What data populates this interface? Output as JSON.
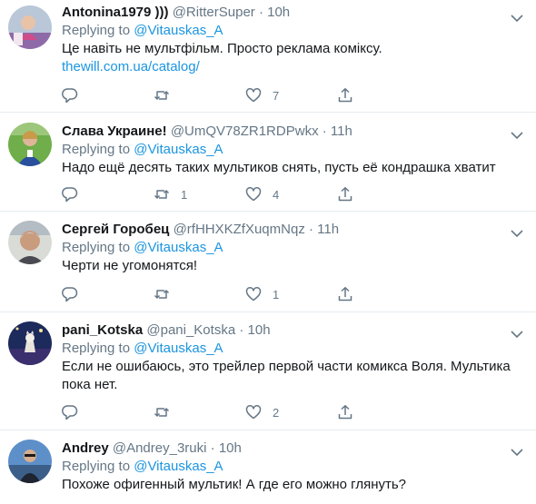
{
  "replying_label": "Replying to",
  "tweets": [
    {
      "name": "Antonina1979 )))",
      "handle": "@RitterSuper",
      "time": "10h",
      "reply_to": "@Vitauskas_A",
      "text": "Це навіть не мультфільм. Просто реклама коміксу.",
      "link": "thewill.com.ua/catalog/",
      "replies": "",
      "retweets": "",
      "likes": "7"
    },
    {
      "name": "Слава Украине!",
      "handle": "@UmQV78ZR1RDPwkx",
      "time": "11h",
      "reply_to": "@Vitauskas_A",
      "text": "Надо ещё десять таких мультиков снять, пусть её кондрашка хватит",
      "replies": "",
      "retweets": "1",
      "likes": "4"
    },
    {
      "name": "Сергей Горобец",
      "handle": "@rfHHXKZfXuqmNqz",
      "time": "11h",
      "reply_to": "@Vitauskas_A",
      "text": "Черти не угомонятся!",
      "replies": "",
      "retweets": "",
      "likes": "1"
    },
    {
      "name": "pani_Kotska",
      "handle": "@pani_Kotska",
      "time": "10h",
      "reply_to": "@Vitauskas_A",
      "text": "Если не ошибаюсь, это трейлер первой части комикса Воля. Мультика пока нет.",
      "replies": "",
      "retweets": "",
      "likes": "2"
    },
    {
      "name": "Andrey",
      "handle": "@Andrey_3ruki",
      "time": "10h",
      "reply_to": "@Vitauskas_A",
      "text": "Похоже офигенный мультик! А где его можно глянуть?"
    }
  ]
}
